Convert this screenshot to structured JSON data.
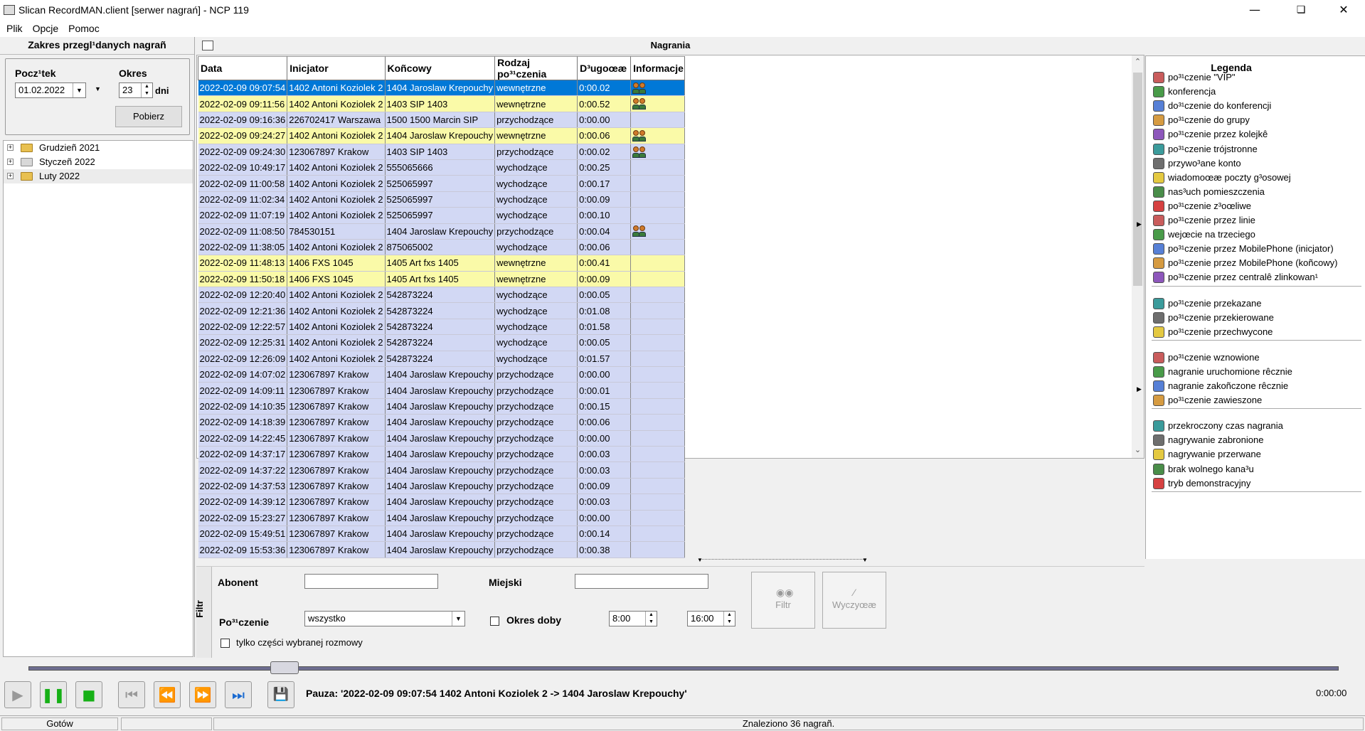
{
  "window": {
    "title": "Slican RecordMAN.client [serwer nagrań] - NCP 119"
  },
  "menu": [
    "Plik",
    "Opcje",
    "Pomoc"
  ],
  "left": {
    "header": "Zakres przegl¹danych nagrañ",
    "start_label": "Pocz¹tek",
    "start_value": "01.02.2022",
    "period_label": "Okres",
    "period_value": "23",
    "period_unit": "dni",
    "fetch_button": "Pobierz",
    "tree": [
      {
        "label": "Grudzieñ 2021",
        "folder": "open"
      },
      {
        "label": "Styczeñ 2022",
        "folder": "gray"
      },
      {
        "label": "Luty 2022",
        "folder": "open"
      }
    ]
  },
  "center": {
    "title": "Nagrania"
  },
  "grid": {
    "columns": [
      "Data",
      "Inicjator",
      "Koñcowy",
      "Rodzaj po³¹czenia",
      "D³ugoœæ",
      "Informacje"
    ],
    "rows": [
      {
        "d": "2022-02-09 09:07:54",
        "i": "1402 Antoni Koziolek 2",
        "k": "1404 Jaroslaw Krepouchy",
        "r": "wewnętrzne",
        "l": "0:00.02",
        "info": true,
        "c": "sel"
      },
      {
        "d": "2022-02-09 09:11:56",
        "i": "1402 Antoni Koziolek 2",
        "k": "1403 SIP 1403",
        "r": "wewnętrzne",
        "l": "0:00.52",
        "info": true,
        "c": "yellow"
      },
      {
        "d": "2022-02-09 09:16:36",
        "i": "226702417 Warszawa",
        "k": "1500 1500 Marcin SIP",
        "r": "przychodzące",
        "l": "0:00.00",
        "info": false,
        "c": "blue"
      },
      {
        "d": "2022-02-09 09:24:27",
        "i": "1402 Antoni Koziolek 2",
        "k": "1404 Jaroslaw Krepouchy",
        "r": "wewnętrzne",
        "l": "0:00.06",
        "info": true,
        "c": "yellow"
      },
      {
        "d": "2022-02-09 09:24:30",
        "i": "123067897 Krakow",
        "k": "1403 SIP 1403",
        "r": "przychodzące",
        "l": "0:00.02",
        "info": true,
        "c": "blue"
      },
      {
        "d": "2022-02-09 10:49:17",
        "i": "1402 Antoni Koziolek 2",
        "k": "555065666",
        "r": "wychodzące",
        "l": "0:00.25",
        "info": false,
        "c": "blue"
      },
      {
        "d": "2022-02-09 11:00:58",
        "i": "1402 Antoni Koziolek 2",
        "k": "525065997",
        "r": "wychodzące",
        "l": "0:00.17",
        "info": false,
        "c": "blue"
      },
      {
        "d": "2022-02-09 11:02:34",
        "i": "1402 Antoni Koziolek 2",
        "k": "525065997",
        "r": "wychodzące",
        "l": "0:00.09",
        "info": false,
        "c": "blue"
      },
      {
        "d": "2022-02-09 11:07:19",
        "i": "1402 Antoni Koziolek 2",
        "k": "525065997",
        "r": "wychodzące",
        "l": "0:00.10",
        "info": false,
        "c": "blue"
      },
      {
        "d": "2022-02-09 11:08:50",
        "i": "784530151",
        "k": "1404 Jaroslaw Krepouchy",
        "r": "przychodzące",
        "l": "0:00.04",
        "info": true,
        "c": "blue"
      },
      {
        "d": "2022-02-09 11:38:05",
        "i": "1402 Antoni Koziolek 2",
        "k": "875065002",
        "r": "wychodzące",
        "l": "0:00.06",
        "info": false,
        "c": "blue"
      },
      {
        "d": "2022-02-09 11:48:13",
        "i": "1406 FXS 1045",
        "k": "1405 Art fxs 1405",
        "r": "wewnętrzne",
        "l": "0:00.41",
        "info": false,
        "c": "yellow"
      },
      {
        "d": "2022-02-09 11:50:18",
        "i": "1406 FXS 1045",
        "k": "1405 Art fxs 1405",
        "r": "wewnętrzne",
        "l": "0:00.09",
        "info": false,
        "c": "yellow"
      },
      {
        "d": "2022-02-09 12:20:40",
        "i": "1402 Antoni Koziolek 2",
        "k": "542873224",
        "r": "wychodzące",
        "l": "0:00.05",
        "info": false,
        "c": "blue"
      },
      {
        "d": "2022-02-09 12:21:36",
        "i": "1402 Antoni Koziolek 2",
        "k": "542873224",
        "r": "wychodzące",
        "l": "0:01.08",
        "info": false,
        "c": "blue"
      },
      {
        "d": "2022-02-09 12:22:57",
        "i": "1402 Antoni Koziolek 2",
        "k": "542873224",
        "r": "wychodzące",
        "l": "0:01.58",
        "info": false,
        "c": "blue"
      },
      {
        "d": "2022-02-09 12:25:31",
        "i": "1402 Antoni Koziolek 2",
        "k": "542873224",
        "r": "wychodzące",
        "l": "0:00.05",
        "info": false,
        "c": "blue"
      },
      {
        "d": "2022-02-09 12:26:09",
        "i": "1402 Antoni Koziolek 2",
        "k": "542873224",
        "r": "wychodzące",
        "l": "0:01.57",
        "info": false,
        "c": "blue"
      },
      {
        "d": "2022-02-09 14:07:02",
        "i": "123067897 Krakow",
        "k": "1404 Jaroslaw Krepouchy",
        "r": "przychodzące",
        "l": "0:00.00",
        "info": false,
        "c": "blue"
      },
      {
        "d": "2022-02-09 14:09:11",
        "i": "123067897 Krakow",
        "k": "1404 Jaroslaw Krepouchy",
        "r": "przychodzące",
        "l": "0:00.01",
        "info": false,
        "c": "blue"
      },
      {
        "d": "2022-02-09 14:10:35",
        "i": "123067897 Krakow",
        "k": "1404 Jaroslaw Krepouchy",
        "r": "przychodzące",
        "l": "0:00.15",
        "info": false,
        "c": "blue"
      },
      {
        "d": "2022-02-09 14:18:39",
        "i": "123067897 Krakow",
        "k": "1404 Jaroslaw Krepouchy",
        "r": "przychodzące",
        "l": "0:00.06",
        "info": false,
        "c": "blue"
      },
      {
        "d": "2022-02-09 14:22:45",
        "i": "123067897 Krakow",
        "k": "1404 Jaroslaw Krepouchy",
        "r": "przychodzące",
        "l": "0:00.00",
        "info": false,
        "c": "blue"
      },
      {
        "d": "2022-02-09 14:37:17",
        "i": "123067897 Krakow",
        "k": "1404 Jaroslaw Krepouchy",
        "r": "przychodzące",
        "l": "0:00.03",
        "info": false,
        "c": "blue"
      },
      {
        "d": "2022-02-09 14:37:22",
        "i": "123067897 Krakow",
        "k": "1404 Jaroslaw Krepouchy",
        "r": "przychodzące",
        "l": "0:00.03",
        "info": false,
        "c": "blue"
      },
      {
        "d": "2022-02-09 14:37:53",
        "i": "123067897 Krakow",
        "k": "1404 Jaroslaw Krepouchy",
        "r": "przychodzące",
        "l": "0:00.09",
        "info": false,
        "c": "blue"
      },
      {
        "d": "2022-02-09 14:39:12",
        "i": "123067897 Krakow",
        "k": "1404 Jaroslaw Krepouchy",
        "r": "przychodzące",
        "l": "0:00.03",
        "info": false,
        "c": "blue"
      },
      {
        "d": "2022-02-09 15:23:27",
        "i": "123067897 Krakow",
        "k": "1404 Jaroslaw Krepouchy",
        "r": "przychodzące",
        "l": "0:00.00",
        "info": false,
        "c": "blue"
      },
      {
        "d": "2022-02-09 15:49:51",
        "i": "123067897 Krakow",
        "k": "1404 Jaroslaw Krepouchy",
        "r": "przychodzące",
        "l": "0:00.14",
        "info": false,
        "c": "blue"
      },
      {
        "d": "2022-02-09 15:53:36",
        "i": "123067897 Krakow",
        "k": "1404 Jaroslaw Krepouchy",
        "r": "przychodzące",
        "l": "0:00.38",
        "info": false,
        "c": "blue"
      }
    ]
  },
  "legend": {
    "title": "Legenda",
    "groups": [
      [
        {
          "icon": "vip-person-icon",
          "label": "po³¹czenie \"VIP\""
        },
        {
          "icon": "conference-icon",
          "label": "konferencja"
        },
        {
          "icon": "join-conference-icon",
          "label": "do³¹czenie do konferencji"
        },
        {
          "icon": "group-call-icon",
          "label": "po³¹czenie do grupy"
        },
        {
          "icon": "queue-call-icon",
          "label": "po³¹czenie przez kolejkê"
        },
        {
          "icon": "three-way-call-icon",
          "label": "po³¹czenie trójstronne"
        },
        {
          "icon": "assigned-account-icon",
          "label": "przywo³ane konto"
        },
        {
          "icon": "voicemail-icon",
          "label": "wiadomoœæ poczty g³osowej"
        },
        {
          "icon": "room-monitoring-icon",
          "label": "nas³uch pomieszczenia"
        },
        {
          "icon": "emergency-call-icon",
          "label": "po³¹czenie z³oœliwe"
        },
        {
          "icon": "line-call-icon",
          "label": "po³¹czenie przez linie"
        },
        {
          "icon": "barge-in-icon",
          "label": "wejœcie na trzeciego"
        },
        {
          "icon": "mobilephone-initiator-icon",
          "label": "po³¹czenie przez MobilePhone (inicjator)"
        },
        {
          "icon": "mobilephone-final-icon",
          "label": "po³¹czenie przez MobilePhone (koñcowy)"
        },
        {
          "icon": "linked-exchange-icon",
          "label": "po³¹czenie przez centralê zlinkowan¹"
        }
      ],
      [
        {
          "icon": "transferred-call-icon",
          "label": "po³¹czenie przekazane"
        },
        {
          "icon": "redirected-call-icon",
          "label": "po³¹czenie przekierowane"
        },
        {
          "icon": "intercepted-call-icon",
          "label": "po³¹czenie przechwycone"
        }
      ],
      [
        {
          "icon": "resumed-icon",
          "label": "po³¹czenie wznowione"
        },
        {
          "icon": "manual-start-icon",
          "label": "nagranie uruchomione rêcznie"
        },
        {
          "icon": "manual-stop-icon",
          "label": "nagranie zakoñczone rêcznie"
        },
        {
          "icon": "paused-icon",
          "label": "po³¹czenie zawieszone"
        }
      ],
      [
        {
          "icon": "time-exceeded-icon",
          "label": "przekroczony czas nagrania"
        },
        {
          "icon": "recording-forbidden-icon",
          "label": "nagrywanie zabronione"
        },
        {
          "icon": "recording-interrupted-icon",
          "label": "nagrywanie przerwane"
        },
        {
          "icon": "no-channel-icon",
          "label": "brak wolnego kana³u"
        },
        {
          "icon": "demo-mode-icon",
          "label": "tryb demonstracyjny"
        }
      ]
    ]
  },
  "filter": {
    "tab": "Filtr",
    "abonent_label": "Abonent",
    "abonent_value": "",
    "miejski_label": "Miejski",
    "miejski_value": "",
    "call_label": "Po³¹czenie",
    "call_value": "wszystko",
    "daytime_label": "Okres doby",
    "time_from": "8:00",
    "time_to": "16:00",
    "only_part_label": "tylko części wybranej rozmowy",
    "filter_button": "Filtr",
    "clear_button": "Wyczyœæ"
  },
  "player": {
    "status_text": "Pauza: '2022-02-09 09:07:54  1402 Antoni Koziolek 2 -> 1404 Jaroslaw Krepouchy'",
    "time": "0:00:00",
    "progress": 0.0
  },
  "statusbar": {
    "left": "Gotów",
    "right": "Znaleziono 36 nagrañ."
  },
  "colors": {
    "selected": "#0078d7",
    "row_blue": "#d2d8f4",
    "row_yellow": "#fafaa8"
  }
}
